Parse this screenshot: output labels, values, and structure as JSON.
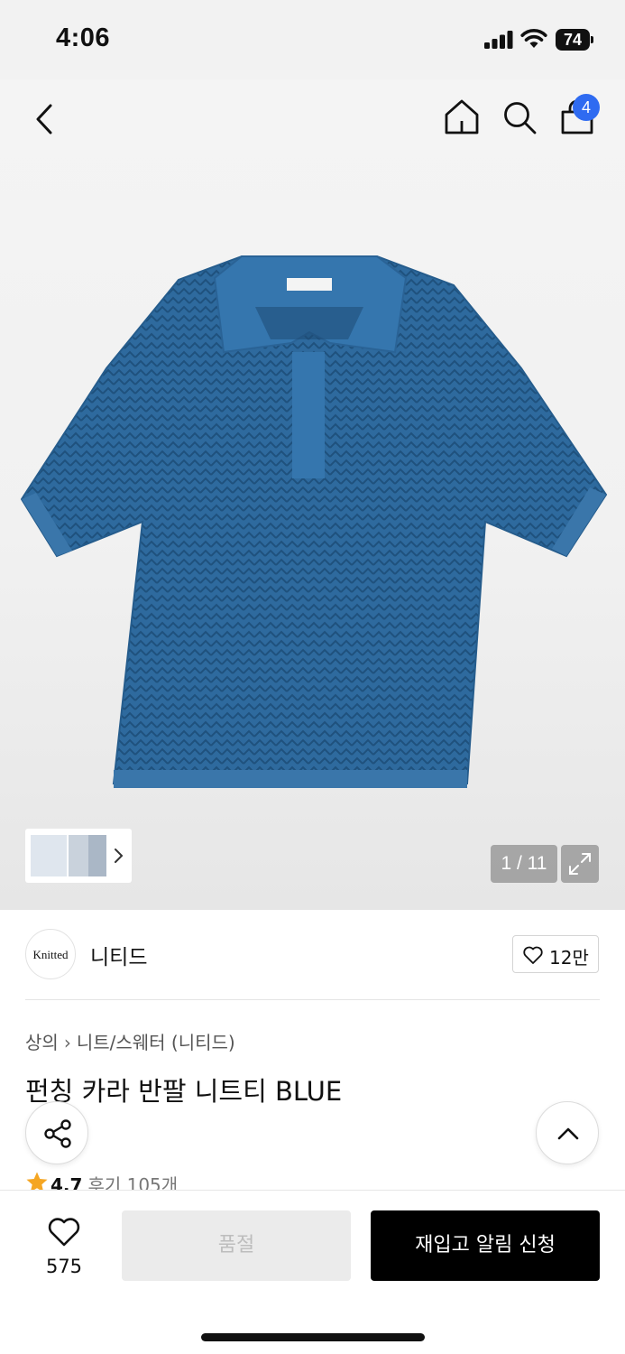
{
  "status_bar": {
    "time": "4:06",
    "battery": "74"
  },
  "header": {
    "icons": [
      "back-icon",
      "home-icon",
      "search-icon",
      "shopping-bag-icon"
    ],
    "cart_count": "4"
  },
  "gallery": {
    "page_indicator": "1 / 11"
  },
  "brand": {
    "logo_text": "Knitted",
    "name": "니티드",
    "likes": "12만"
  },
  "product": {
    "breadcrumb": [
      "상의",
      "니트/스웨터 (니티드)"
    ],
    "title": "펀칭 카라 반팔 니트티 BLUE",
    "rating": "4.7",
    "review_label": "후기 105개",
    "color": "#2e6a9e"
  },
  "bottom_bar": {
    "wish_count": "575",
    "soldout_label": "품절",
    "restock_label": "재입고 알림 신청"
  }
}
